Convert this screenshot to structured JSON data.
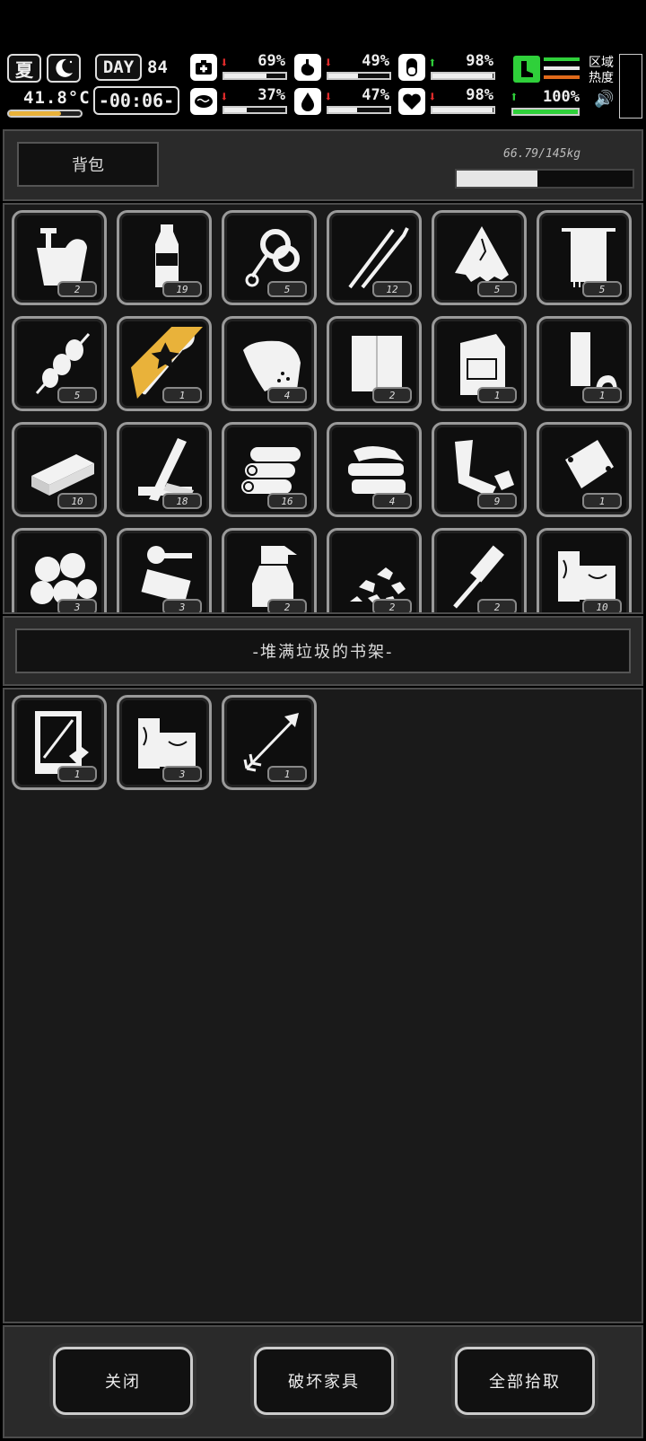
{
  "hud": {
    "season": "夏",
    "temperature": "41.8°C",
    "temperature_level": 0.72,
    "day_label": "DAY",
    "day_number": "84",
    "clock": "-00:06-",
    "stats": [
      {
        "icon": "medkit-icon",
        "direction": "down",
        "value": "69%",
        "level": 0.69
      },
      {
        "icon": "stomach-icon",
        "direction": "down",
        "value": "49%",
        "level": 0.49
      },
      {
        "icon": "pill-icon",
        "direction": "up",
        "value": "98%",
        "level": 0.98
      },
      {
        "icon": "brain-icon",
        "direction": "down",
        "value": "37%",
        "level": 0.37
      },
      {
        "icon": "water-drop-icon",
        "direction": "down",
        "value": "47%",
        "level": 0.47
      },
      {
        "icon": "heart-icon",
        "direction": "down",
        "value": "98%",
        "level": 0.98
      }
    ],
    "stamina": {
      "direction": "up",
      "value": "100%",
      "level": 1.0,
      "colors": [
        "#2fd03a",
        "#e8e8e8",
        "#e06a1a"
      ]
    },
    "region_heat_label": "区域热度"
  },
  "backpack": {
    "title": "背包",
    "weight_text": "66.79/145kg",
    "weight_fraction": 0.46,
    "items": [
      {
        "icon": "ice-bucket-icon",
        "count": "2"
      },
      {
        "icon": "water-bottle-icon",
        "count": "19"
      },
      {
        "icon": "rope-icon",
        "count": "5"
      },
      {
        "icon": "lockpick-icon",
        "count": "12"
      },
      {
        "icon": "torn-cloth-icon",
        "count": "5"
      },
      {
        "icon": "towel-icon",
        "count": "5"
      },
      {
        "icon": "meat-skewer-icon",
        "count": "5"
      },
      {
        "icon": "shovel-icon",
        "count": "1",
        "starred": true
      },
      {
        "icon": "sack-icon",
        "count": "4"
      },
      {
        "icon": "paper-sheets-icon",
        "count": "2"
      },
      {
        "icon": "seed-packet-icon",
        "count": "1"
      },
      {
        "icon": "tape-roll-icon",
        "count": "1"
      },
      {
        "icon": "wood-plank-icon",
        "count": "10"
      },
      {
        "icon": "broken-boards-icon",
        "count": "18"
      },
      {
        "icon": "logs-icon",
        "count": "16"
      },
      {
        "icon": "folded-cloth-icon",
        "count": "4"
      },
      {
        "icon": "scrap-parts-icon",
        "count": "9"
      },
      {
        "icon": "plastic-bag-icon",
        "count": "1"
      },
      {
        "icon": "cotton-balls-icon",
        "count": "3"
      },
      {
        "icon": "machine-parts-icon",
        "count": "3"
      },
      {
        "icon": "spray-bottle-icon",
        "count": "2"
      },
      {
        "icon": "stone-rubble-icon",
        "count": "2"
      },
      {
        "icon": "hammer-icon",
        "count": "2"
      },
      {
        "icon": "wood-blocks-icon",
        "count": "10"
      }
    ]
  },
  "container": {
    "title": "-堆满垃圾的书架-",
    "items": [
      {
        "icon": "blueprint-icon",
        "count": "1"
      },
      {
        "icon": "wood-blocks-icon",
        "count": "3"
      },
      {
        "icon": "arrow-icon",
        "count": "1"
      }
    ]
  },
  "footer": {
    "close_label": "关闭",
    "destroy_label": "破坏家具",
    "take_all_label": "全部拾取"
  }
}
